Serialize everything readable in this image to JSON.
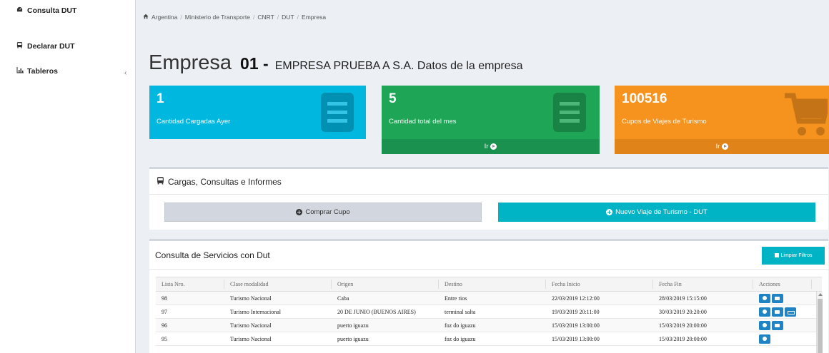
{
  "sidebar": {
    "items": [
      {
        "label": "Consulta DUT",
        "icon": "dashboard-icon"
      },
      {
        "label": "Declarar DUT",
        "icon": "bus-icon"
      },
      {
        "label": "Tableros",
        "icon": "bar-chart-icon"
      }
    ],
    "chevron": "‹"
  },
  "breadcrumb": [
    "Argentina",
    "Ministerio de Transporte",
    "CNRT",
    "DUT",
    "Empresa"
  ],
  "title": {
    "main": "Empresa",
    "code": "01 -",
    "sub": "EMPRESA PRUEBA A S.A. Datos de la empresa"
  },
  "stats": [
    {
      "value": "1",
      "label": "Cantidad Cargadas Ayer",
      "color": "#00b7e0",
      "icon": "document-icon"
    },
    {
      "value": "5",
      "label": "Cantidad total del mes",
      "footer": "Ir",
      "color": "#1fa556",
      "icon": "document-icon"
    },
    {
      "value": "100516",
      "label": "Cupos de Viajes de Turismo",
      "footer": "Ir",
      "color": "#f6921e",
      "icon": "cart-icon"
    }
  ],
  "cargas": {
    "title": "Cargas, Consultas e Informes",
    "buy_label": "Comprar Cupo",
    "new_label": "Nuevo Viaje de Turismo - DUT"
  },
  "consulta": {
    "title": "Consulta de Servicios con Dut",
    "clear_label": "Limpiar Filtros",
    "columns": [
      "Lista Nro.",
      "Clase modalidad",
      "Origen",
      "Destino",
      "Fecha Inicio",
      "Fecha Fin",
      "Acciones"
    ],
    "rows": [
      {
        "nro": "98",
        "clase": "Turismo Nacional",
        "origen": "Caba",
        "destino": "Entre rios",
        "inicio": "22/03/2019 12:12:00",
        "fin": "28/03/2019 15:15:00",
        "actions": [
          "view",
          "print"
        ]
      },
      {
        "nro": "97",
        "clase": "Turismo Internacional",
        "origen": "20 DE JUNIO (BUENOS AIRES)",
        "destino": "terminal salta",
        "inicio": "19/03/2019 20:11:00",
        "fin": "30/03/2019 20:20:00",
        "actions": [
          "view",
          "print",
          "retweet"
        ]
      },
      {
        "nro": "96",
        "clase": "Turismo Nacional",
        "origen": "puerto iguazu",
        "destino": "foz do iguazu",
        "inicio": "15/03/2019 13:00:00",
        "fin": "15/03/2019 20:00:00",
        "actions": [
          "view",
          "print"
        ]
      },
      {
        "nro": "95",
        "clase": "Turismo Nacional",
        "origen": "puerto iguazu",
        "destino": "foz do iguazu",
        "inicio": "15/03/2019 13:00:00",
        "fin": "15/03/2019 20:00:00",
        "actions": [
          "view"
        ]
      }
    ]
  }
}
